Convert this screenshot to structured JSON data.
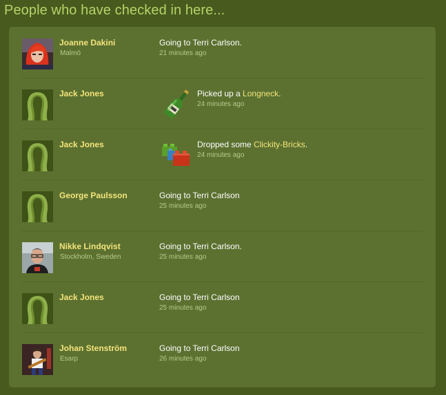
{
  "heading": "People who have checked in here...",
  "checkins": [
    {
      "user": "Joanne Dakini",
      "location": "Malmö",
      "avatar": "photo-red-hair",
      "action_text": "Going to Terri Carlson.",
      "action_link": "",
      "action_suffix": "",
      "time": "21 minutes ago",
      "item_icon": ""
    },
    {
      "user": "Jack Jones",
      "location": "",
      "avatar": "default-silhouette",
      "action_text": "Picked up a ",
      "action_link": "Longneck",
      "action_suffix": ".",
      "time": "24 minutes ago",
      "item_icon": "longneck-bottle-icon"
    },
    {
      "user": "Jack Jones",
      "location": "",
      "avatar": "default-silhouette",
      "action_text": "Dropped some ",
      "action_link": "Clickity-Bricks",
      "action_suffix": ".",
      "time": "24 minutes ago",
      "item_icon": "clickity-bricks-icon"
    },
    {
      "user": "George Paulsson",
      "location": "",
      "avatar": "default-silhouette",
      "action_text": "Going to Terri Carlson",
      "action_link": "",
      "action_suffix": "",
      "time": "25 minutes ago",
      "item_icon": ""
    },
    {
      "user": "Nikke Lindqvist",
      "location": "Stockholm, Sweden",
      "avatar": "photo-man-glasses",
      "action_text": "Going to Terri Carlson.",
      "action_link": "",
      "action_suffix": "",
      "time": "25 minutes ago",
      "item_icon": ""
    },
    {
      "user": "Jack Jones",
      "location": "",
      "avatar": "default-silhouette",
      "action_text": "Going to Terri Carlson",
      "action_link": "",
      "action_suffix": "",
      "time": "25 minutes ago",
      "item_icon": ""
    },
    {
      "user": "Johan Stenström",
      "location": "Esarp",
      "avatar": "photo-guitarist",
      "action_text": "Going to Terri Carlson",
      "action_link": "",
      "action_suffix": "",
      "time": "26 minutes ago",
      "item_icon": ""
    }
  ],
  "colors": {
    "background": "#485a1d",
    "panel": "#5c7130",
    "heading": "#b6d36a",
    "username": "#f3e47c",
    "link": "#f3e47c",
    "meta": "#b9c98c",
    "text": "#ffffff"
  }
}
